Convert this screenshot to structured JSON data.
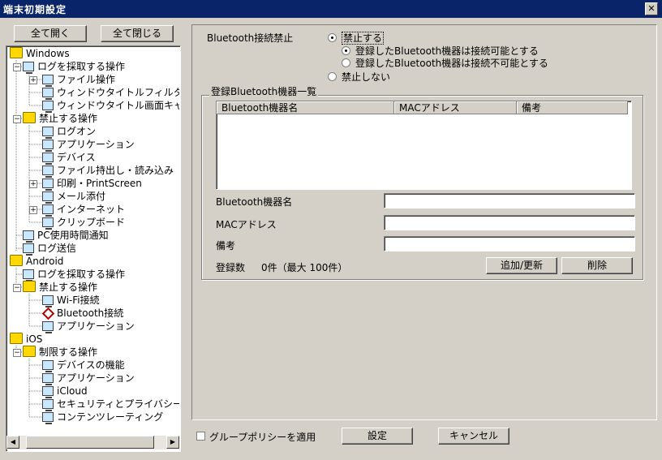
{
  "window": {
    "title": "端末初期設定",
    "close_glyph": "✕"
  },
  "tree_controls": {
    "expand_all": "全て開く",
    "collapse_all": "全て閉じる"
  },
  "tree": {
    "windows": "Windows",
    "win_log": "ログを採取する操作",
    "win_log_file": "ファイル操作",
    "win_log_winfilter": "ウィンドウタイトルフィルタ",
    "win_log_wincap": "ウィンドウタイトル画面キャプチャ",
    "win_prohibit": "禁止する操作",
    "win_p_logon": "ログオン",
    "win_p_app": "アプリケーション",
    "win_p_device": "デバイス",
    "win_p_file": "ファイル持出し・読み込み",
    "win_p_print": "印刷・PrintScreen",
    "win_p_mail": "メール添付",
    "win_p_internet": "インターネット",
    "win_p_clip": "クリップボード",
    "win_pc_time": "PC使用時間通知",
    "win_log_send": "ログ送信",
    "android": "Android",
    "and_log": "ログを採取する操作",
    "and_prohibit": "禁止する操作",
    "and_wifi": "Wi-Fi接続",
    "and_bt": "Bluetooth接続",
    "and_app": "アプリケーション",
    "ios": "iOS",
    "ios_restrict": "制限する操作",
    "ios_device": "デバイスの機能",
    "ios_app": "アプリケーション",
    "ios_icloud": "iCloud",
    "ios_security": "セキュリティとプライバシー",
    "ios_rating": "コンテンツレーティング"
  },
  "settings": {
    "bt_prohibit_label": "Bluetooth接続禁止",
    "opt_prohibit": "禁止する",
    "opt_registered_allowed": "登録したBluetooth機器は接続可能とする",
    "opt_registered_denied": "登録したBluetooth機器は接続不可能とする",
    "opt_not_prohibit": "禁止しない",
    "group_title": "登録Bluetooth機器一覧",
    "columns": [
      "Bluetooth機器名",
      "MACアドレス",
      "備考"
    ],
    "rows": [],
    "field_name_label": "Bluetooth機器名",
    "field_mac_label": "MACアドレス",
    "field_note_label": "備考",
    "field_name_value": "",
    "field_mac_value": "",
    "field_note_value": "",
    "count_label": "登録数",
    "count_value": "0件（最大 100件）",
    "add_update": "追加/更新",
    "delete": "削除"
  },
  "footer": {
    "group_policy": "グループポリシーを適用",
    "apply": "設定",
    "cancel": "キャンセル"
  }
}
